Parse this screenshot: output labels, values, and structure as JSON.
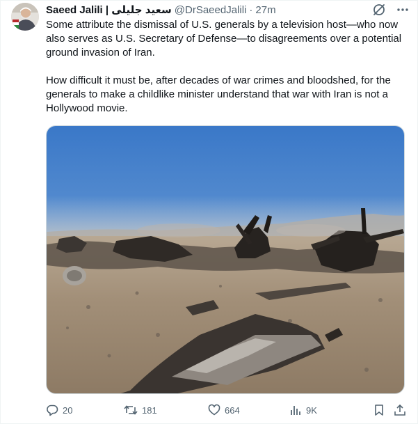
{
  "author": {
    "display_name": "Saeed Jalili | سعید جلیلی",
    "handle": "@DrSaeedJalili",
    "separator": "·",
    "time": "27m"
  },
  "icons": {
    "grok": "grok-slash-icon",
    "more": "more-dots-icon",
    "reply": "reply-icon",
    "retweet": "retweet-icon",
    "like": "heart-icon",
    "views": "views-chart-icon",
    "bookmark": "bookmark-icon",
    "share": "share-icon"
  },
  "tweet": {
    "paragraph1": "Some attribute the dismissal of U.S. generals by a television host—who now also serves as U.S. Secretary of Defense—to disagreements over a potential ground invasion of Iran.",
    "paragraph2": "How difficult it must be, after decades of war crimes and bloodshed, for the generals to make a childlike minister understand that war with Iran is not a Hollywood movie."
  },
  "stats": {
    "replies": "20",
    "retweets": "181",
    "likes": "664",
    "views": "9K"
  },
  "colors": {
    "text": "#0f1419",
    "muted": "#536471",
    "border": "#cfd9de"
  }
}
